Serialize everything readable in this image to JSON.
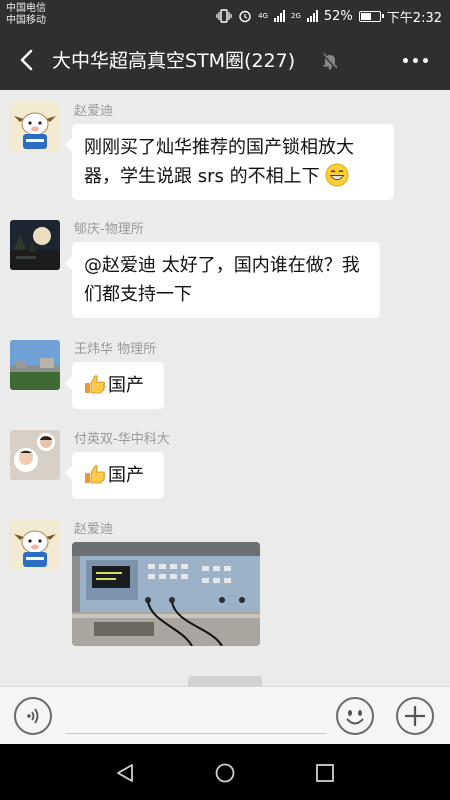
{
  "status_bar": {
    "carrier_1": "中国电信",
    "carrier_2": "中国移动",
    "network_1": "4G",
    "network_2": "2G",
    "battery": "52%",
    "time": "下午2:32"
  },
  "header": {
    "title": "大中华超高真空STM圈(227)"
  },
  "messages": [
    {
      "sender": "赵爱迪",
      "text": "刚刚买了灿华推荐的国产锁相放大器，学生说跟 srs 的不相上下"
    },
    {
      "sender": "郇庆-物理所",
      "text": "@赵爱迪  太好了，国内谁在做？我们都支持一下"
    },
    {
      "sender": "王炜华 物理所",
      "text": "国产"
    },
    {
      "sender": "付英双-华中科大",
      "text": "国产"
    },
    {
      "sender": "赵爱迪",
      "text": ""
    }
  ],
  "icons": {
    "back": "back-arrow-icon",
    "mute": "mute-bell-icon",
    "more": "more-icon",
    "voice": "voice-icon",
    "emoji": "emoji-icon",
    "plus": "plus-icon",
    "thumbs": "thumbs-up-icon",
    "grin": "grin-emoji-icon"
  },
  "colors": {
    "header_bg": "#2f2f2f",
    "chat_bg": "#ebebeb",
    "bubble_bg": "#ffffff",
    "sender_text": "#9a9a9a",
    "nav_bg": "#000000"
  }
}
